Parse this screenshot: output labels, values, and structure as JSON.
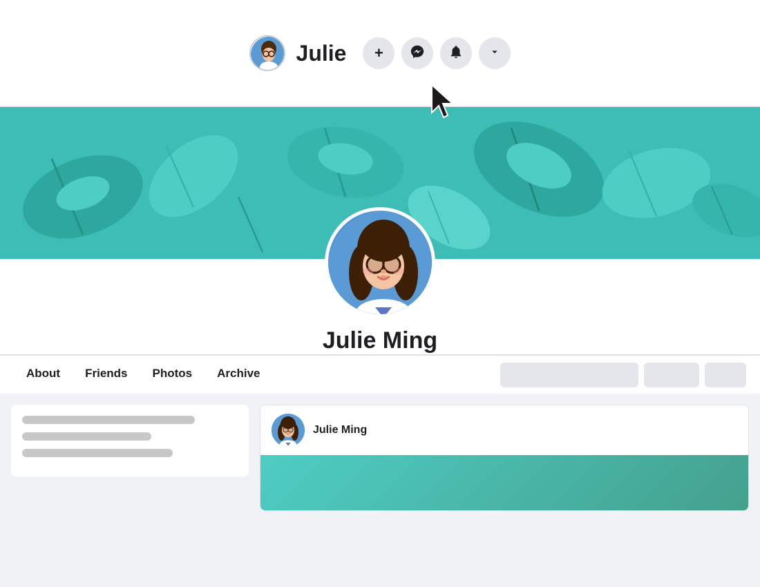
{
  "navbar": {
    "username": "Julie",
    "icons": [
      {
        "name": "add",
        "symbol": "+",
        "label": "add-icon"
      },
      {
        "name": "messenger",
        "symbol": "💬",
        "label": "messenger-icon"
      },
      {
        "name": "notifications",
        "symbol": "🔔",
        "label": "notifications-icon"
      },
      {
        "name": "dropdown",
        "symbol": "▼",
        "label": "dropdown-icon"
      }
    ]
  },
  "profile": {
    "name": "Julie Ming"
  },
  "tabs": [
    {
      "label": "About",
      "id": "about"
    },
    {
      "label": "Friends",
      "id": "friends"
    },
    {
      "label": "Photos",
      "id": "photos"
    },
    {
      "label": "Archive",
      "id": "archive"
    }
  ],
  "post": {
    "username": "Julie Ming"
  }
}
